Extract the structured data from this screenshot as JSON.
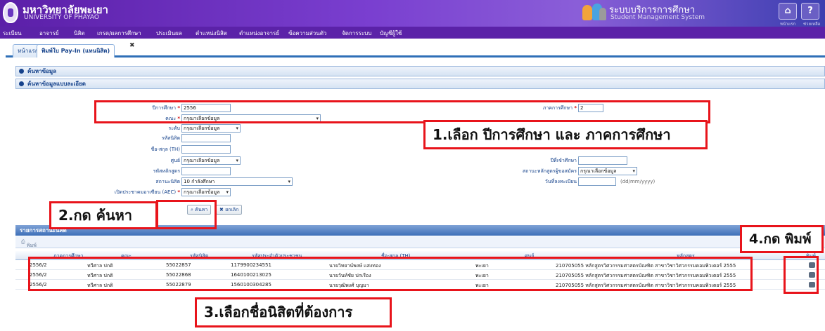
{
  "header": {
    "university_th": "มหาวิทยาลัยพะเยา",
    "university_en": "UNIVERSITY OF PHAYAO",
    "system_th": "ระบบบริการการศึกษา",
    "system_en": "Student Management System",
    "home_label": "หน้าแรก",
    "help_label": "ช่วยเหลือ"
  },
  "menu": [
    "ระเบียน",
    "อาจารย์",
    "นิสิต",
    "เกรด/ผลการศึกษา",
    "ประเมินผล",
    "ตำแหน่งนิสิต",
    "ตำแหน่งอาจารย์",
    "ข้อความส่วนตัว",
    "จัดการระบบ",
    "บัญชีผู้ใช้"
  ],
  "tabs": {
    "home": "หน้าแรก",
    "active": "พิมพ์ใบ Pay-In (แทนนิสิต)"
  },
  "panels": {
    "search": "ค้นหาข้อมูล",
    "detail": "ค้นหาข้อมูลแบบละเอียด"
  },
  "form": {
    "year_label": "ปีการศึกษา",
    "year_value": "2556",
    "semester_label": "ภาคการศึกษา",
    "semester_value": "2",
    "faculty_label": "คณะ",
    "faculty_value": "กรุณาเลือกข้อมูล",
    "level_label": "ระดับ",
    "level_value": "กรุณาเลือกข้อมูล",
    "student_id_label": "รหัสนิสิต",
    "name_label": "ชื่อ-สกุล (TH)",
    "center_label": "ศูนย์",
    "center_value": "กรุณาเลือกข้อมูล",
    "entry_year_label": "ปีที่เข้าศึกษา",
    "program_code_label": "รหัสหลักสูตร",
    "program_status_label": "สถานะหลักสูตรผู้ขอสมัคร",
    "program_status_value": "กรุณาเลือกข้อมูล",
    "student_status_label": "สถานะนิสิต",
    "student_status_value": "10 กำลังศึกษา",
    "reg_date_label": "วันที่ลงทะเบียน",
    "date_hint": "(dd/mm/yyyy)",
    "aec_label": "เปิดประชาคมอาเซียน (AEC)",
    "aec_value": "กรุณาเลือกข้อมูล",
    "search_btn": "ค้นหา",
    "cancel_btn": "ยกเลิก"
  },
  "results": {
    "title": "รายการสถานะนิสิต",
    "toolbar_btn": "พิมพ์รายการ",
    "columns": [
      "ภาคการศึกษา",
      "คณะ",
      "รหัสนิสิต",
      "รหัสประจำตัวประชาชน",
      "ชื่อ-สกุล (TH)",
      "ศูนย์",
      "หลักสูตร",
      "พิมพ์"
    ],
    "rows": [
      [
        "2556/2",
        "ทวีศาล ปกติ",
        "55022857",
        "1179900234551",
        "นายวิทยาน์พงษ์ แสงทอง",
        "พะเยา",
        "210705055 หลักสูตรวิศวกรรมศาสตรบัณฑิต สาขาวิชาวิศวกรรมคอมพิวเตอร์ 2555"
      ],
      [
        "2556/2",
        "ทวีศาล ปกติ",
        "55022868",
        "1640100213025",
        "นายวันท์ชัย ปกเรือง",
        "พะเยา",
        "210705055 หลักสูตรวิศวกรรมศาสตรบัณฑิต สาขาวิชาวิศวกรรมคอมพิวเตอร์ 2555"
      ],
      [
        "2556/2",
        "ทวีศาล ปกติ",
        "55022879",
        "1560100304285",
        "นายวุฒิพงศ์ บุญมา",
        "พะเยา",
        "210705055 หลักสูตรวิศวกรรมศาสตรบัณฑิต สาขาวิชาวิศวกรรมคอมพิวเตอร์ 2555"
      ]
    ]
  },
  "annotations": {
    "step1": "1.เลือก ปีการศึกษา และ ภาคการศึกษา",
    "step2": "2.กด ค้นหา",
    "step3": "3.เลือกชื่อนิสิตที่ต้องการ",
    "step4": "4.กด พิมพ์"
  },
  "colors": {
    "header": "#5b1fa8",
    "accent": "#2f6fb7",
    "annotation": "#e8141b"
  }
}
